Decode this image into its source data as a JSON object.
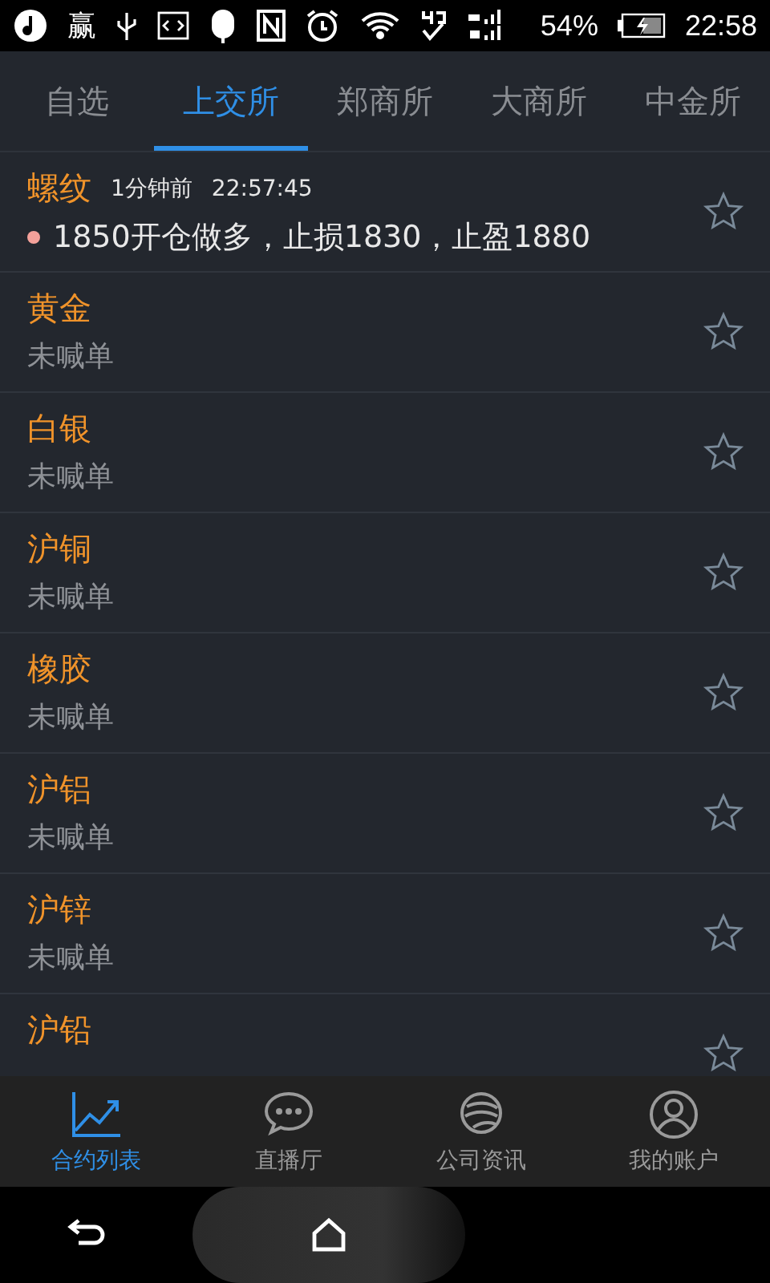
{
  "status_bar": {
    "app_badge": "赢",
    "battery": "54%",
    "time": "22:58"
  },
  "tabs": [
    {
      "label": "自选",
      "selected": false
    },
    {
      "label": "上交所",
      "selected": true
    },
    {
      "label": "郑商所",
      "selected": false
    },
    {
      "label": "大商所",
      "selected": false
    },
    {
      "label": "中金所",
      "selected": false
    }
  ],
  "contracts": [
    {
      "name": "螺纹",
      "time_ago": "1分钟前",
      "time": "22:57:45",
      "signal": "1850开仓做多，止损1830，止盈1880",
      "starred": false
    },
    {
      "name": "黄金",
      "status": "未喊单",
      "starred": false
    },
    {
      "name": "白银",
      "status": "未喊单",
      "starred": false
    },
    {
      "name": "沪铜",
      "status": "未喊单",
      "starred": false
    },
    {
      "name": "橡胶",
      "status": "未喊单",
      "starred": false
    },
    {
      "name": "沪铝",
      "status": "未喊单",
      "starred": false
    },
    {
      "name": "沪锌",
      "status": "未喊单",
      "starred": false
    },
    {
      "name": "沪铅",
      "starred": false
    }
  ],
  "bottom_nav": [
    {
      "label": "合约列表",
      "kind": "chart",
      "selected": true
    },
    {
      "label": "直播厅",
      "kind": "chat",
      "selected": false
    },
    {
      "label": "公司资讯",
      "kind": "globe",
      "selected": false
    },
    {
      "label": "我的账户",
      "kind": "user",
      "selected": false
    }
  ]
}
